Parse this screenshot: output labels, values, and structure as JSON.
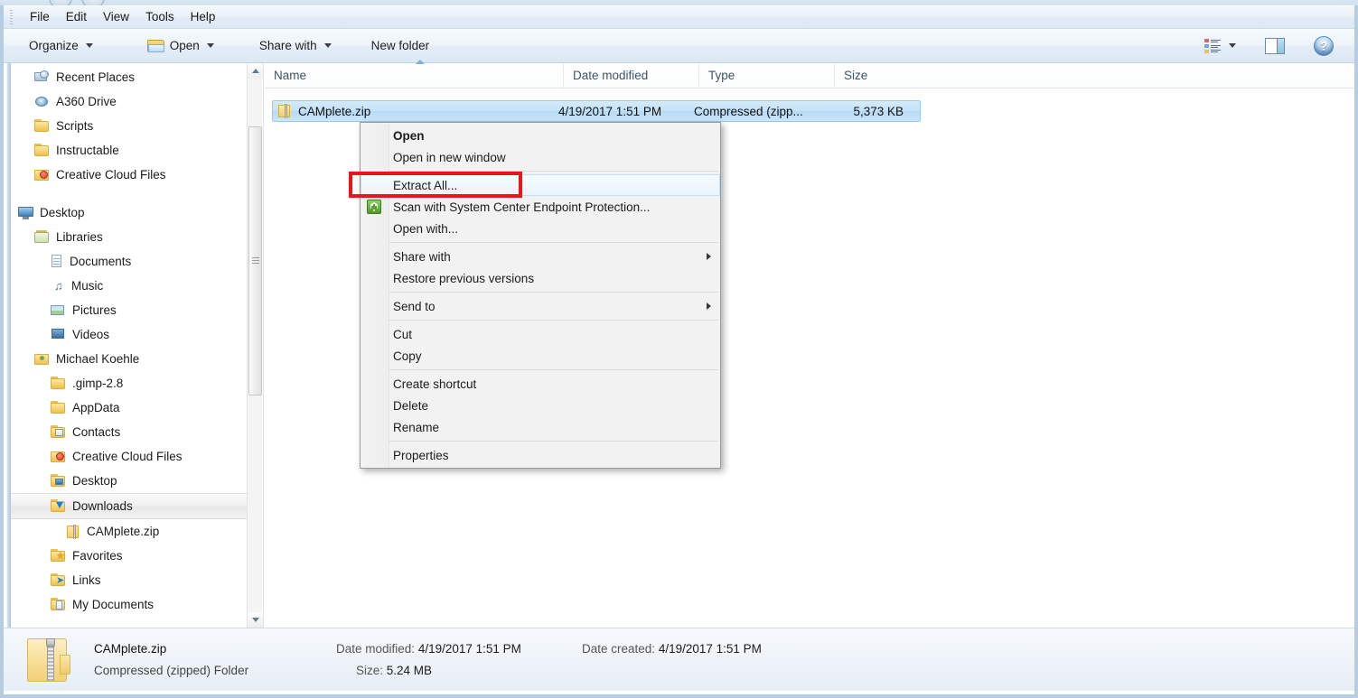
{
  "window": {
    "menu_items": [
      "File",
      "Edit",
      "View",
      "Tools",
      "Help"
    ]
  },
  "toolbar": {
    "organize_label": "Organize",
    "open_label": "Open",
    "share_with_label": "Share with",
    "new_folder_label": "New folder",
    "help_glyph": "?"
  },
  "sidebar": {
    "items": [
      {
        "label": "Recent Places",
        "icon": "recent-places-icon",
        "indent": 1,
        "type": "recent",
        "selected": false
      },
      {
        "label": "A360 Drive",
        "icon": "a360-drive-icon",
        "indent": 1,
        "type": "disc",
        "selected": false
      },
      {
        "label": "Scripts",
        "icon": "folder-icon",
        "indent": 1,
        "type": "folder",
        "selected": false
      },
      {
        "label": "Instructable",
        "icon": "folder-icon",
        "indent": 1,
        "type": "folder",
        "selected": false
      },
      {
        "label": "Creative Cloud Files",
        "icon": "creative-cloud-folder-icon",
        "indent": 1,
        "type": "cc",
        "selected": false
      },
      {
        "label": "Desktop",
        "icon": "desktop-monitor-icon",
        "indent": 0,
        "type": "monitor",
        "selected": false
      },
      {
        "label": "Libraries",
        "icon": "libraries-icon",
        "indent": 1,
        "type": "lib",
        "selected": false
      },
      {
        "label": "Documents",
        "icon": "documents-library-icon",
        "indent": 2,
        "type": "doc",
        "selected": false
      },
      {
        "label": "Music",
        "icon": "music-library-icon",
        "indent": 2,
        "type": "music",
        "selected": false
      },
      {
        "label": "Pictures",
        "icon": "pictures-library-icon",
        "indent": 2,
        "type": "pic",
        "selected": false
      },
      {
        "label": "Videos",
        "icon": "videos-library-icon",
        "indent": 2,
        "type": "vid",
        "selected": false
      },
      {
        "label": "Michael Koehle",
        "icon": "user-folder-icon",
        "indent": 1,
        "type": "user",
        "selected": false
      },
      {
        "label": ".gimp-2.8",
        "icon": "folder-icon",
        "indent": 2,
        "type": "folder",
        "selected": false
      },
      {
        "label": "AppData",
        "icon": "folder-icon",
        "indent": 2,
        "type": "folder",
        "selected": false
      },
      {
        "label": "Contacts",
        "icon": "contacts-folder-icon",
        "indent": 2,
        "type": "contacts",
        "selected": false
      },
      {
        "label": "Creative Cloud Files",
        "icon": "creative-cloud-folder-icon",
        "indent": 2,
        "type": "cc",
        "selected": false
      },
      {
        "label": "Desktop",
        "icon": "desktop-folder-icon",
        "indent": 2,
        "type": "deskfold",
        "selected": false
      },
      {
        "label": "Downloads",
        "icon": "downloads-folder-icon",
        "indent": 2,
        "type": "downloads",
        "selected": true
      },
      {
        "label": "CAMplete.zip",
        "icon": "zip-folder-icon",
        "indent": 3,
        "type": "zip",
        "selected": false
      },
      {
        "label": "Favorites",
        "icon": "favorites-folder-icon",
        "indent": 2,
        "type": "favorites",
        "selected": false
      },
      {
        "label": "Links",
        "icon": "links-folder-icon",
        "indent": 2,
        "type": "links",
        "selected": false
      },
      {
        "label": "My Documents",
        "icon": "my-documents-folder-icon",
        "indent": 2,
        "type": "mydoc",
        "selected": false
      }
    ]
  },
  "columns": [
    {
      "label": "Name",
      "sorted": true
    },
    {
      "label": "Date modified",
      "sorted": false
    },
    {
      "label": "Type",
      "sorted": false
    },
    {
      "label": "Size",
      "sorted": false
    }
  ],
  "files": [
    {
      "name": "CAMplete.zip",
      "date_modified": "4/19/2017 1:51 PM",
      "type": "Compressed (zipp...",
      "size": "5,373 KB",
      "selected": true
    }
  ],
  "context_menu": {
    "items": [
      {
        "label": "Open",
        "bold": true,
        "submenu": false,
        "icon": null,
        "highlighted": false,
        "separator_after": false
      },
      {
        "label": "Open in new window",
        "bold": false,
        "submenu": false,
        "icon": null,
        "highlighted": false,
        "separator_after": true
      },
      {
        "label": "Extract All...",
        "bold": false,
        "submenu": false,
        "icon": null,
        "highlighted": true,
        "separator_after": false
      },
      {
        "label": "Scan with System Center Endpoint Protection...",
        "bold": false,
        "submenu": false,
        "icon": "shield-icon",
        "highlighted": false,
        "separator_after": false
      },
      {
        "label": "Open with...",
        "bold": false,
        "submenu": false,
        "icon": null,
        "highlighted": false,
        "separator_after": true
      },
      {
        "label": "Share with",
        "bold": false,
        "submenu": true,
        "icon": null,
        "highlighted": false,
        "separator_after": false
      },
      {
        "label": "Restore previous versions",
        "bold": false,
        "submenu": false,
        "icon": null,
        "highlighted": false,
        "separator_after": true
      },
      {
        "label": "Send to",
        "bold": false,
        "submenu": true,
        "icon": null,
        "highlighted": false,
        "separator_after": true
      },
      {
        "label": "Cut",
        "bold": false,
        "submenu": false,
        "icon": null,
        "highlighted": false,
        "separator_after": false
      },
      {
        "label": "Copy",
        "bold": false,
        "submenu": false,
        "icon": null,
        "highlighted": false,
        "separator_after": true
      },
      {
        "label": "Create shortcut",
        "bold": false,
        "submenu": false,
        "icon": null,
        "highlighted": false,
        "separator_after": false
      },
      {
        "label": "Delete",
        "bold": false,
        "submenu": false,
        "icon": null,
        "highlighted": false,
        "separator_after": false
      },
      {
        "label": "Rename",
        "bold": false,
        "submenu": false,
        "icon": null,
        "highlighted": false,
        "separator_after": true
      },
      {
        "label": "Properties",
        "bold": false,
        "submenu": false,
        "icon": null,
        "highlighted": false,
        "separator_after": false
      }
    ]
  },
  "annotation": {
    "target_label": "Extract All...",
    "color": "#e8151b"
  },
  "details_pane": {
    "file_name": "CAMplete.zip",
    "file_type": "Compressed (zipped) Folder",
    "date_modified_label": "Date modified:",
    "date_modified_value": "4/19/2017 1:51 PM",
    "size_label": "Size:",
    "size_value": "5.24 MB",
    "date_created_label": "Date created:",
    "date_created_value": "4/19/2017 1:51 PM"
  }
}
